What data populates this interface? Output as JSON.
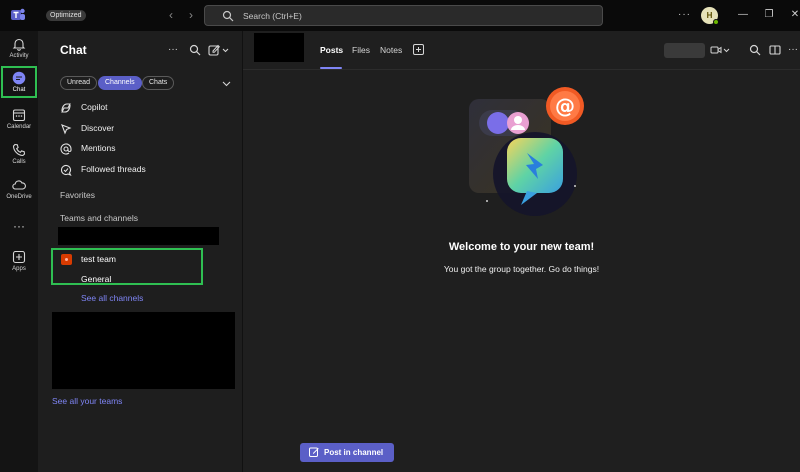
{
  "titlebar": {
    "badge": "Optimized",
    "search_placeholder": "Search (Ctrl+E)",
    "avatar_initial": "H"
  },
  "rail": {
    "items": [
      {
        "label": "Activity",
        "icon": "bell-icon"
      },
      {
        "label": "Chat",
        "icon": "chat-icon"
      },
      {
        "label": "Calendar",
        "icon": "calendar-icon"
      },
      {
        "label": "Calls",
        "icon": "phone-icon"
      },
      {
        "label": "OneDrive",
        "icon": "cloud-icon"
      },
      {
        "label": "Apps",
        "icon": "plus-box-icon"
      }
    ]
  },
  "panel": {
    "title": "Chat",
    "filters": [
      "Unread",
      "Channels",
      "Chats"
    ],
    "nav": [
      "Copilot",
      "Discover",
      "Mentions",
      "Followed threads"
    ],
    "favorites": "Favorites",
    "teams_and_channels": "Teams and channels",
    "team_name": "test team",
    "channel_name": "General",
    "see_all_channels": "See all channels",
    "see_all_teams": "See all your teams"
  },
  "main": {
    "tabs": [
      "Posts",
      "Files",
      "Notes"
    ],
    "welcome_title": "Welcome to your new team!",
    "welcome_sub": "You got the group together. Go do things!",
    "post_button": "Post in channel"
  },
  "colors": {
    "accent": "#5b5fc7",
    "link": "#7f85f5",
    "highlight_box": "#2fbf52",
    "team_icon": "#d83b01"
  }
}
